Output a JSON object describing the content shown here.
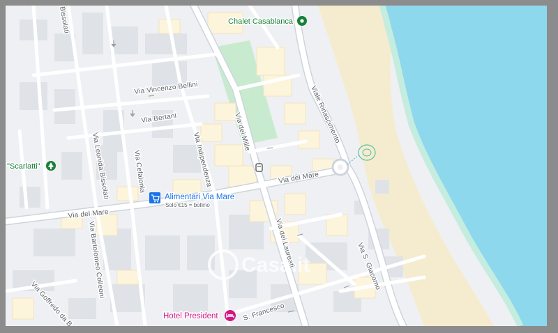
{
  "map": {
    "streets": {
      "via_del_mare_west": "Via del Mare",
      "via_del_mare_east": "Via del Mare",
      "via_vincenzo_bellini": "Via Vincenzo Bellini",
      "via_bertani": "Via Bertani",
      "via_leonida_bissolati": "Via Leonida Bissolati",
      "via_bissolati": "Bissolati",
      "via_cefalonia": "Via Cefalonia",
      "via_indipendenza": "Via Indipendenza",
      "via_dei_mille": "Via dei Mille",
      "viale_rinascimento": "Viale Rinascimento",
      "via_bartolomeo_colleoni": "Via Bartolomeo Colleoni",
      "via_goffredo_da": "Via Goffredo da B",
      "via_dei_laureati": "Via dei Laureati",
      "via_s_giacomo": "Via S. Giacomo",
      "via_s_francesco": "S. Francesco"
    },
    "pois": {
      "chalet": {
        "name": "Chalet Casablanca",
        "color": "#188038"
      },
      "scarlatti": {
        "name": "\"Scarlatti\"",
        "color": "#188038"
      },
      "alimentari": {
        "name": "Alimentari Via Mare",
        "subtitle": "Solo €15 = bollino",
        "color": "#1a73e8"
      },
      "hotel": {
        "name": "Hotel President",
        "color": "#d01884"
      }
    },
    "watermark": "Casa.it",
    "colors": {
      "sea": "#8ed8ed",
      "beach": "#f5ecd0",
      "park": "#c8ebd0",
      "road": "#ffffff",
      "block": "#fdf4dc"
    }
  }
}
